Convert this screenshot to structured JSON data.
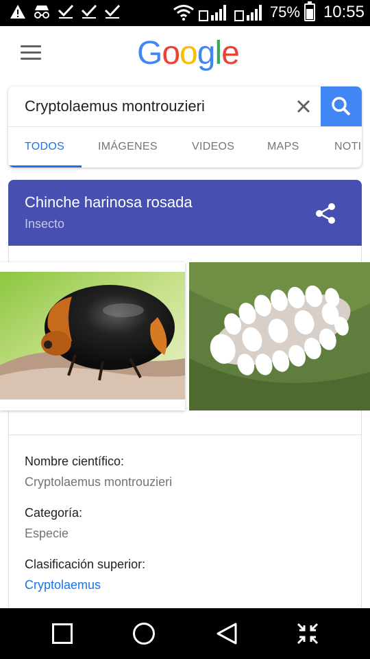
{
  "status_bar": {
    "battery": "75%",
    "time": "10:55",
    "sim1": "1",
    "sim2": "2"
  },
  "header": {
    "logo": [
      "G",
      "o",
      "o",
      "g",
      "l",
      "e"
    ]
  },
  "search": {
    "query": "Cryptolaemus montrouzieri",
    "tabs": [
      {
        "label": "TODOS",
        "active": true
      },
      {
        "label": "IMÁGENES",
        "active": false
      },
      {
        "label": "VIDEOS",
        "active": false
      },
      {
        "label": "MAPS",
        "active": false
      },
      {
        "label": "NOTI",
        "active": false
      }
    ]
  },
  "knowledge_panel": {
    "title": "Chinche harinosa rosada",
    "subtitle": "Insecto",
    "facts": [
      {
        "label": "Nombre científico:",
        "value": "Cryptolaemus montrouzieri",
        "link": false
      },
      {
        "label": "Categoría:",
        "value": "Especie",
        "link": false
      },
      {
        "label": "Clasificación superior:",
        "value": "Cryptolaemus",
        "link": true
      }
    ]
  },
  "colors": {
    "accent_blue": "#4285F4",
    "panel_header": "#4750b0",
    "link": "#1a73e8"
  }
}
